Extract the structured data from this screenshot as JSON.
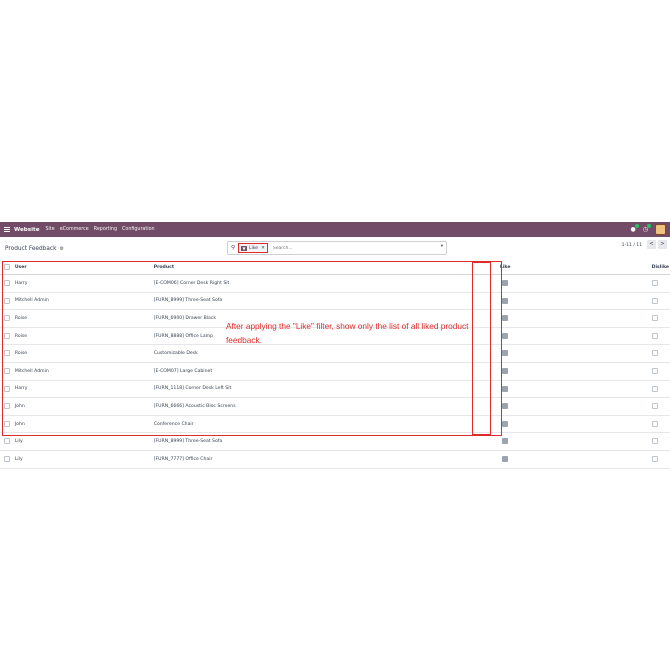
{
  "navbar": {
    "brand": "Website",
    "menu": [
      "Site",
      "eCommerce",
      "Reporting",
      "Configuration"
    ],
    "icons": [
      "apps-grid-icon",
      "chat-icon",
      "activity-icon",
      "avatar"
    ]
  },
  "control": {
    "title": "Product Feedback",
    "filter_facet": "Like",
    "search_placeholder": "Search...",
    "pager": "1-11 / 11",
    "prev": "<",
    "next": ">"
  },
  "table": {
    "headers": {
      "user": "User",
      "product": "Product",
      "like": "Like",
      "dislike": "Dislike"
    },
    "rows": [
      {
        "user": "Harry",
        "product": "[E-COM06] Corner Desk Right Sit",
        "like": true,
        "dislike": false
      },
      {
        "user": "Mitchell Admin",
        "product": "[FURN_8999] Three-Seat Sofa",
        "like": true,
        "dislike": false
      },
      {
        "user": "Roise",
        "product": "[FURN_6900] Drawer Black",
        "like": true,
        "dislike": false
      },
      {
        "user": "Roise",
        "product": "[FURN_8888] Office Lamp",
        "like": true,
        "dislike": false
      },
      {
        "user": "Roise",
        "product": "Customizable Desk",
        "like": true,
        "dislike": false
      },
      {
        "user": "Mitchell Admin",
        "product": "[E-COM07] Large Cabinet",
        "like": true,
        "dislike": false
      },
      {
        "user": "Harry",
        "product": "[FURN_1118] Corner Desk Left Sit",
        "like": true,
        "dislike": false
      },
      {
        "user": "John",
        "product": "[FURN_6666] Acoustic Bloc Screens",
        "like": true,
        "dislike": false
      },
      {
        "user": "John",
        "product": "Conference Chair",
        "like": true,
        "dislike": false
      },
      {
        "user": "Lily",
        "product": "[FURN_8999] Three-Seat Sofa",
        "like": true,
        "dislike": false
      },
      {
        "user": "Lily",
        "product": "[FURN_7777] Office Chair",
        "like": true,
        "dislike": false
      }
    ]
  },
  "annotation": "After applying the \"Like\" filter, show only the list of all liked product feedback.",
  "colors": {
    "navbar": "#714b67",
    "highlight": "#e02b2b"
  }
}
